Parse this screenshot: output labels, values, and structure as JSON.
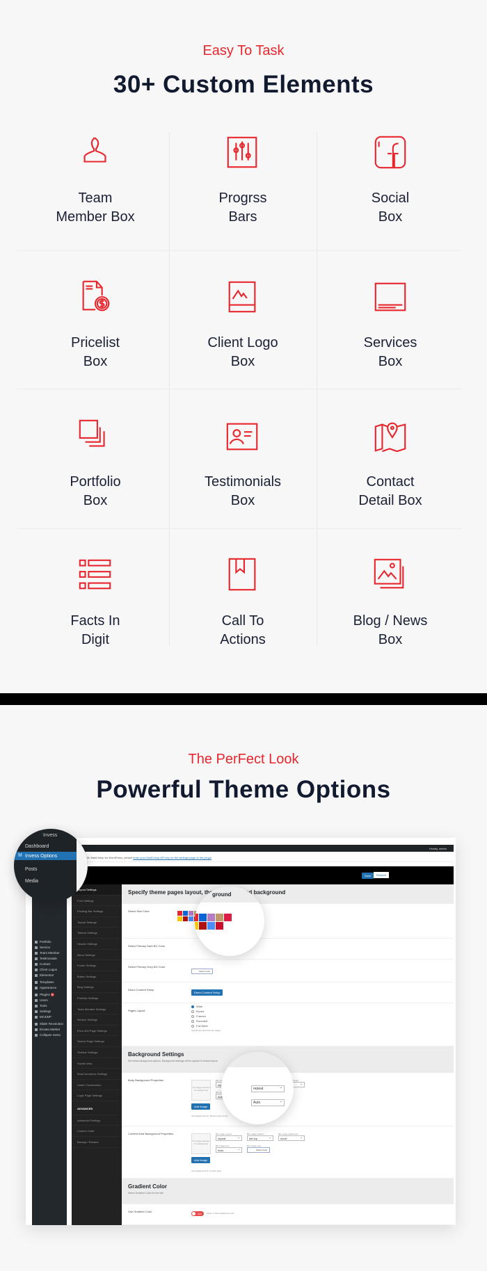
{
  "section1": {
    "eyebrow": "Easy To Task",
    "title": "30+ Custom Elements",
    "elements": [
      {
        "line1": "Team",
        "line2": "Member Box",
        "icon": "user-icon"
      },
      {
        "line1": "Progrss",
        "line2": "Bars",
        "icon": "sliders-icon"
      },
      {
        "line1": "Social",
        "line2": "Box",
        "icon": "facebook-icon"
      },
      {
        "line1": "Pricelist",
        "line2": "Box",
        "icon": "price-document-icon"
      },
      {
        "line1": "Client Logo",
        "line2": "Box",
        "icon": "image-frame-icon"
      },
      {
        "line1": "Services",
        "line2": "Box",
        "icon": "monitor-icon"
      },
      {
        "line1": "Portfolio",
        "line2": "Box",
        "icon": "stacked-squares-icon"
      },
      {
        "line1": "Testimonials",
        "line2": "Box",
        "icon": "id-card-icon"
      },
      {
        "line1": "Contact",
        "line2": "Detail Box",
        "icon": "map-pin-icon"
      },
      {
        "line1": "Facts In",
        "line2": "Digit",
        "icon": "list-icon"
      },
      {
        "line1": "Call To",
        "line2": "Actions",
        "icon": "bookmark-icon"
      },
      {
        "line1": "Blog / News",
        "line2": "Box",
        "icon": "gallery-icon"
      }
    ]
  },
  "section2": {
    "eyebrow": "The PerFect Look",
    "title": "Powerful Theme Options"
  },
  "colors": {
    "accent": "#e8262d",
    "heading": "#121a30",
    "wp_blue": "#2271b1",
    "wp_dark": "#23282d"
  },
  "wp": {
    "site_name": "Invess",
    "admin_bar_left": "New",
    "admin_bar_right": "Howdy, admin",
    "notice_text": "started with MailChimp for WordPress, please",
    "notice_link": "enter your MailChimp API key on the settings page of the plugin",
    "options_title": "In",
    "save": "Save",
    "restore": "Restore",
    "sidebar": [
      "Dashboard",
      "Invess Options",
      "Posts",
      "Media",
      "Portfolio",
      "Service",
      "Team Member",
      "Testimonials",
      "Contact",
      "Client Logos",
      "Elementor",
      "Templates",
      "Appearance",
      "Plugins",
      "Users",
      "Tools",
      "Settings",
      "MC4WP",
      "Slider Revolution",
      "Envato Market",
      "Collapse menu"
    ],
    "plugins_badge": "6",
    "settings_menu": [
      "Layout Settings",
      "Font Settings",
      "Floating Bar Settings",
      "Topbar Settings",
      "Titlebar Settings",
      "Header Settings",
      "Menu Settings",
      "Footer Settings",
      "Button Settings",
      "Blog Settings",
      "Portfolio Settings",
      "Team Member Settings",
      "Service Settings",
      "Error 404 Page Settings",
      "Search Page Settings",
      "Sidebar Settings",
      "Social Links",
      "WooCommerce Settings",
      "Under Construction",
      "Login Page Settings",
      "ADVANCED",
      "Advanced Settings",
      "Custom Code",
      "Backup / Restore"
    ],
    "layout_heading": "Specify theme pages layout, the skin color and background",
    "skin_label": "Select Skin Color",
    "skin_swatches": [
      "#e8262d",
      "#0b63d6",
      "#b57cc0",
      "#c19a6b",
      "#dc1e44",
      "#f7c600",
      "#b01010",
      "#4d8df7",
      "#c8102e"
    ],
    "or_label": "\"OR\"",
    "custom_color": "#e21b1b",
    "color_saved": "Save",
    "select_color": "Select Color",
    "dark_bg_label": "Select Primary Dark BG Color",
    "grey_bg_label": "Select Primary Grey BG Color",
    "demo_label": "Demo Content Setup",
    "demo_button": "Demo Content Setup",
    "pages_layout_label": "Pages Layout",
    "layouts": [
      "Wide",
      "Boxed",
      "Framed",
      "Rounded",
      "Full Wide"
    ],
    "layout_selected": "Wide",
    "layout_help": "Specify the layout for the pages",
    "bg_heading": "Background Settings",
    "bg_sub": "Set below background options. Background settings will be applied to Boxed layout",
    "body_bg_label": "Body Background Properties",
    "content_bg_label": "Content Area Background Properties",
    "no_image": "No image selected for background",
    "add_image": "Add image",
    "bg_repeat_cap": "BG image repeat",
    "bg_position_cap": "BG image position",
    "bg_attach_cap": "BG image attachment",
    "bg_size_cap": "BG image size",
    "bg_color_cap": "BG image color",
    "repeat": "repeat",
    "position": "left top",
    "attachment": "scroll",
    "size": "Auto",
    "body_help": "Set background for \"Boxed\" layout only.",
    "content_help": "Set background for content area",
    "gradient_heading": "Gradient Color",
    "gradient_sub": "Select Gradient Color for the site",
    "use_gradient_label": "Use Gradient Color",
    "toggle_off": "OFF",
    "gradient_help": "Show or hide Gradient for site",
    "magnified_heading": "ground"
  }
}
